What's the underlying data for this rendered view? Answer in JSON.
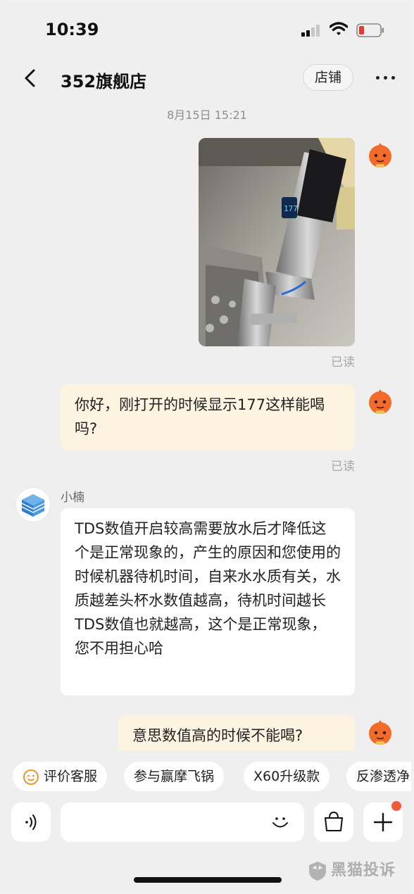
{
  "status_bar": {
    "time": "10:39",
    "battery_color": "#e53935"
  },
  "nav": {
    "title": "352旗舰店",
    "store_button": "店铺"
  },
  "chat": {
    "date": "8月15日 15:21",
    "messages": [
      {
        "from": "me",
        "kind": "image",
        "status": "已读",
        "image_desc_icon": "faucet-photo"
      },
      {
        "from": "me",
        "kind": "text",
        "text": "你好，刚打开的时候显示177这样能喝吗?",
        "status": "已读"
      },
      {
        "from": "agent",
        "name": "小楠",
        "kind": "text",
        "text": "TDS数值开启较高需要放水后才降低这个是正常现象的，产生的原因和您使用的时候机器待机时间，自来水水质有关，水质越差头杯水数值越高，待机时间越长TDS数值也就越高，这个是正常现象，您不用担心哈"
      },
      {
        "from": "me",
        "kind": "text",
        "text": "意思数值高的时候不能喝?"
      }
    ]
  },
  "quick_replies": [
    {
      "label": "评价客服",
      "icon": "smile-icon"
    },
    {
      "label": "参与赢摩飞锅"
    },
    {
      "label": "X60升级款"
    },
    {
      "label": "反渗透净"
    }
  ],
  "input": {
    "placeholder": "",
    "value": ""
  },
  "watermark": "黑猫投诉",
  "colors": {
    "bubble_out": "#fdf3e1",
    "bubble_in": "#ffffff",
    "background": "#efefef",
    "notification_dot": "#f25a3c"
  }
}
